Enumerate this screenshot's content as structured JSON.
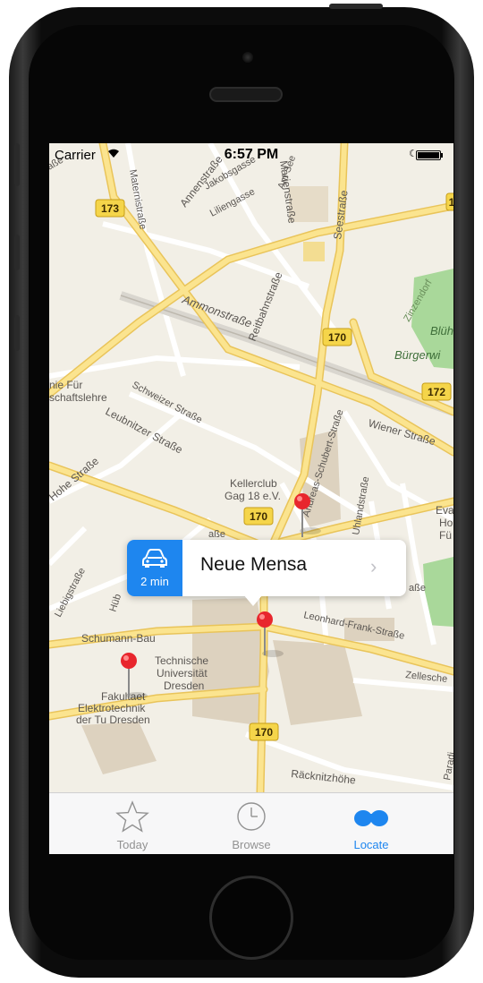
{
  "status_bar": {
    "carrier": "Carrier",
    "time": "6:57 PM"
  },
  "map": {
    "streets": [
      "Maternistraße",
      "Annenstraße",
      "Jakobsgasse",
      "Am See",
      "Liliengasse",
      "Marienstraße",
      "Seestraße",
      "Ammonstraße",
      "Reitbahnstraße",
      "Zinzendorf",
      "Blüh",
      "Bürgerwi",
      "Schweizer Straße",
      "Leubnitzer Straße",
      "Wiener Straße",
      "Hohe Straße",
      "Andreas-Schubert-Straße",
      "Uhlandstraße",
      "Leonhard-Frank-Straße",
      "Zellesche",
      "Liebigstraße",
      "Hüb",
      "Räcknitzhöhe",
      "Paradi",
      "aße",
      "aße",
      "aße"
    ],
    "pois": [
      "nie Für",
      "schaftslehre",
      "Kellerclub",
      "Gag 18 e.V.",
      "Schumann-Bau",
      "Technische",
      "Universität",
      "Dresden",
      "Fakultaet",
      "Elektrotechnik",
      "der Tu Dresden",
      "Eva",
      "Ho",
      "Fü"
    ],
    "route_shields": [
      "173",
      "170",
      "172",
      "170",
      "170",
      "1"
    ]
  },
  "callout": {
    "travel_time": "2 min",
    "title": "Neue Mensa",
    "chevron": "›"
  },
  "tab_bar": {
    "items": [
      {
        "label": "Today",
        "icon": "star-icon"
      },
      {
        "label": "Browse",
        "icon": "clock-icon"
      },
      {
        "label": "Locate",
        "icon": "binoculars-icon"
      }
    ],
    "active_color": "#1e86ef",
    "inactive_color": "#929292"
  },
  "colors": {
    "map_background": "#f2efe6",
    "road_yellow": "#f6d36b",
    "park_green": "#a9d89a",
    "building": "#ddd2bf"
  }
}
